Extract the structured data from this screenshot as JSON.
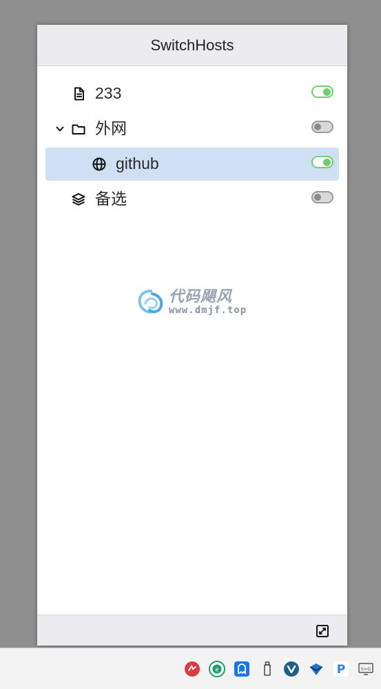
{
  "window": {
    "title": "SwitchHosts"
  },
  "hosts": [
    {
      "label": "233",
      "icon": "file-icon",
      "enabled": true,
      "level": 0,
      "expandable": false,
      "selected": false
    },
    {
      "label": "外网",
      "icon": "folder-icon",
      "enabled": false,
      "level": 0,
      "expandable": true,
      "expanded": true,
      "selected": false
    },
    {
      "label": "github",
      "icon": "globe-icon",
      "enabled": true,
      "level": 1,
      "expandable": false,
      "selected": true
    },
    {
      "label": "备选",
      "icon": "layers-icon",
      "enabled": false,
      "level": 0,
      "expandable": false,
      "selected": false
    }
  ],
  "watermark": {
    "brand": "代码飓风",
    "url": "www.dmjf.top"
  },
  "footer": {
    "expand_icon": "expand-icon"
  },
  "tray": [
    {
      "name": "red-app-icon",
      "color": "#d93a44"
    },
    {
      "name": "edge-green-icon",
      "color": "#1a9a6a"
    },
    {
      "name": "blue-ghost-icon",
      "color": "#1677e5"
    },
    {
      "name": "usb-drive-icon",
      "color": "#444444"
    },
    {
      "name": "v-app-icon",
      "color": "#1e5f8a"
    },
    {
      "name": "feather-icon",
      "color": "#2470c8"
    },
    {
      "name": "paypal-icon",
      "color": "#2f7fe0"
    },
    {
      "name": "display-switch-icon",
      "color": "#555555"
    }
  ],
  "colors": {
    "toggle_on": "#6fcf70",
    "selected_row": "#cfe0f4"
  }
}
